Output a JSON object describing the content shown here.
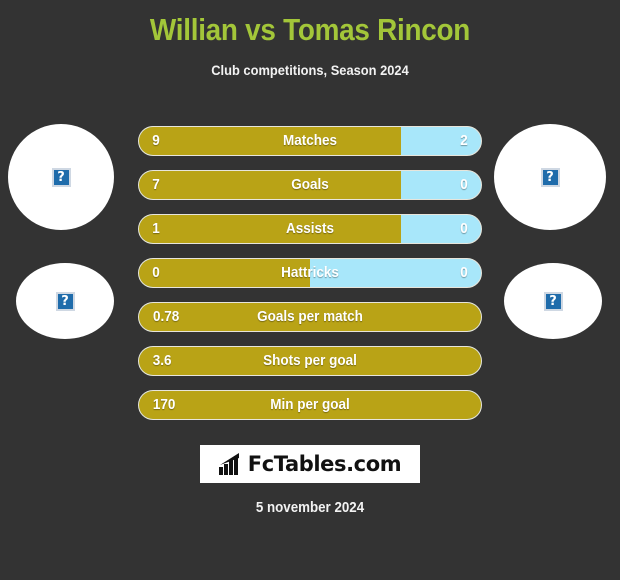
{
  "header": {
    "title": "Willian vs Tomas Rincon",
    "subtitle": "Club competitions, Season 2024",
    "title_color": "#a3c639"
  },
  "colors": {
    "background": "#333333",
    "home_bar": "#b9a316",
    "away_bar": "#a8e7fa",
    "bar_border": "#e7e5db",
    "text": "#ffffff"
  },
  "photos": {
    "home_large": {
      "icon": "broken-image-icon",
      "glyph": "?"
    },
    "away_large": {
      "icon": "broken-image-icon",
      "glyph": "?"
    },
    "home_small": {
      "icon": "broken-image-icon",
      "glyph": "?"
    },
    "away_small": {
      "icon": "broken-image-icon",
      "glyph": "?"
    }
  },
  "chart_data": {
    "type": "bar",
    "title": "Willian vs Tomas Rincon",
    "subtitle": "Club competitions, Season 2024",
    "categories": [
      "Matches",
      "Goals",
      "Assists",
      "Hattricks",
      "Goals per match",
      "Shots per goal",
      "Min per goal"
    ],
    "series": [
      {
        "name": "Willian",
        "values": [
          "9",
          "7",
          "1",
          "0",
          "0.78",
          "3.6",
          "170"
        ]
      },
      {
        "name": "Tomas Rincon",
        "values": [
          "2",
          "0",
          "0",
          "0",
          "",
          "",
          ""
        ]
      }
    ],
    "rows": [
      {
        "label": "Matches",
        "home": "9",
        "away": "2",
        "home_pct": 76.7,
        "split": true
      },
      {
        "label": "Goals",
        "home": "7",
        "away": "0",
        "home_pct": 76.7,
        "split": true
      },
      {
        "label": "Assists",
        "home": "1",
        "away": "0",
        "home_pct": 76.7,
        "split": true
      },
      {
        "label": "Hattricks",
        "home": "0",
        "away": "0",
        "home_pct": 50.0,
        "split": true
      },
      {
        "label": "Goals per match",
        "home": "0.78",
        "away": "",
        "home_pct": 100,
        "split": false
      },
      {
        "label": "Shots per goal",
        "home": "3.6",
        "away": "",
        "home_pct": 100,
        "split": false
      },
      {
        "label": "Min per goal",
        "home": "170",
        "away": "",
        "home_pct": 100,
        "split": false
      }
    ],
    "grid": false,
    "legend": "none",
    "orientation": "horizontal"
  },
  "footer": {
    "logo_text": "FcTables.com",
    "logo_icon": "bar-chart-arrow-icon",
    "date": "5 november 2024"
  }
}
